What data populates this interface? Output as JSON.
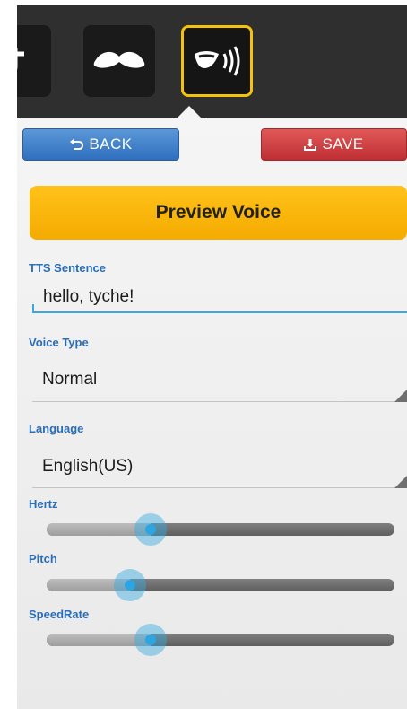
{
  "avatar_tiles": [
    {
      "icon": "glasses-icon",
      "selected": false
    },
    {
      "icon": "mustache-icon",
      "selected": false
    },
    {
      "icon": "mouth-speaking-icon",
      "selected": true
    }
  ],
  "colors": {
    "selected_border": "#f4c20d",
    "back_button": "#3f7fca",
    "save_button": "#d0393d",
    "preview_button": "#ffb300",
    "label": "#2a6db8",
    "slider_thumb": "#2ea5e0"
  },
  "toolbar": {
    "back_label": "BACK",
    "back_icon": "undo-arrow-icon",
    "save_label": "SAVE",
    "save_icon": "download-icon"
  },
  "preview_button_label": "Preview Voice",
  "tts": {
    "label": "TTS Sentence",
    "value": "hello, tyche!"
  },
  "voice_type": {
    "label": "Voice Type",
    "selected": "Normal"
  },
  "language": {
    "label": "Language",
    "selected": "English(US)"
  },
  "sliders": [
    {
      "label": "Hertz",
      "level": 0.3
    },
    {
      "label": "Pitch",
      "level": 0.24
    },
    {
      "label": "SpeedRate",
      "level": 0.3
    }
  ]
}
